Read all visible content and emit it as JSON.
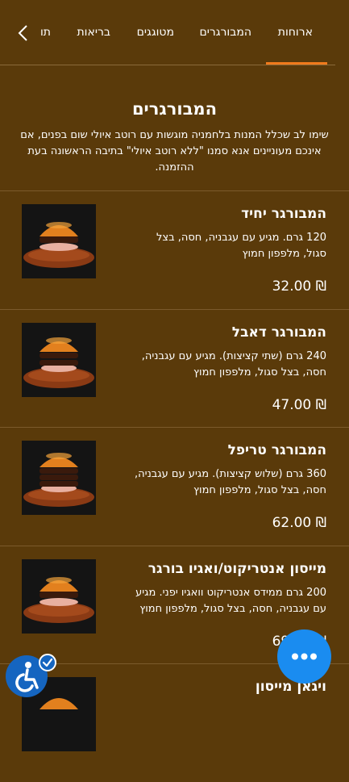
{
  "tabs": [
    {
      "label": "ארוחות",
      "active": true
    },
    {
      "label": "המבורגרים",
      "active": false
    },
    {
      "label": "מטוגגים",
      "active": false
    },
    {
      "label": "בריאות",
      "active": false
    },
    {
      "label": "תו",
      "active": false
    }
  ],
  "section": {
    "title": "המבורגרים",
    "description": "שימו לב שכלל המנות בלחמניה מוגשות עם רוטב איולי שום בפנים, אם אינכם מעוניינים אנא סמנו \"ללא רוטב איולי\" בתיבה הראשונה בעת ההזמנה."
  },
  "items": [
    {
      "name": "המבורגר יחיד",
      "description": "120 גרם. מגיע עם עגבניה, חסה, בצל סגול, מלפפון חמוץ",
      "price": "₪ 32.00"
    },
    {
      "name": "המבורגר דאבל",
      "description": "240 גרם (שתי קציצות). מגיע עם עגבניה, חסה, בצל סגול, מלפפון חמוץ",
      "price": "₪ 47.00"
    },
    {
      "name": "המבורגר טריפל",
      "description": "360 גרם (שלוש קציצות). מגיע עם עגבניה, חסה, בצל סגול, מלפפון חמוץ",
      "price": "₪ 62.00"
    },
    {
      "name": "מייסון אנטריקוט/ואגיו בורגר",
      "description": "200 גרם ממידס אנטריקוט וואגיו יפני. מגיע עם עגבניה, חסה, בצל סגול, מלפפון חמוץ",
      "price": "₪ 69.00"
    },
    {
      "name": "ויגאן מייסון",
      "description": "",
      "price": ""
    }
  ],
  "icons": {
    "back": "chevron-left-icon",
    "fab": "more-dots-icon",
    "accessibility": "wheelchair-icon"
  },
  "colors": {
    "background": "#5a3a0a",
    "accent": "#f07a1c",
    "fab": "#1a8cf0",
    "accessibility": "#1565c0"
  }
}
